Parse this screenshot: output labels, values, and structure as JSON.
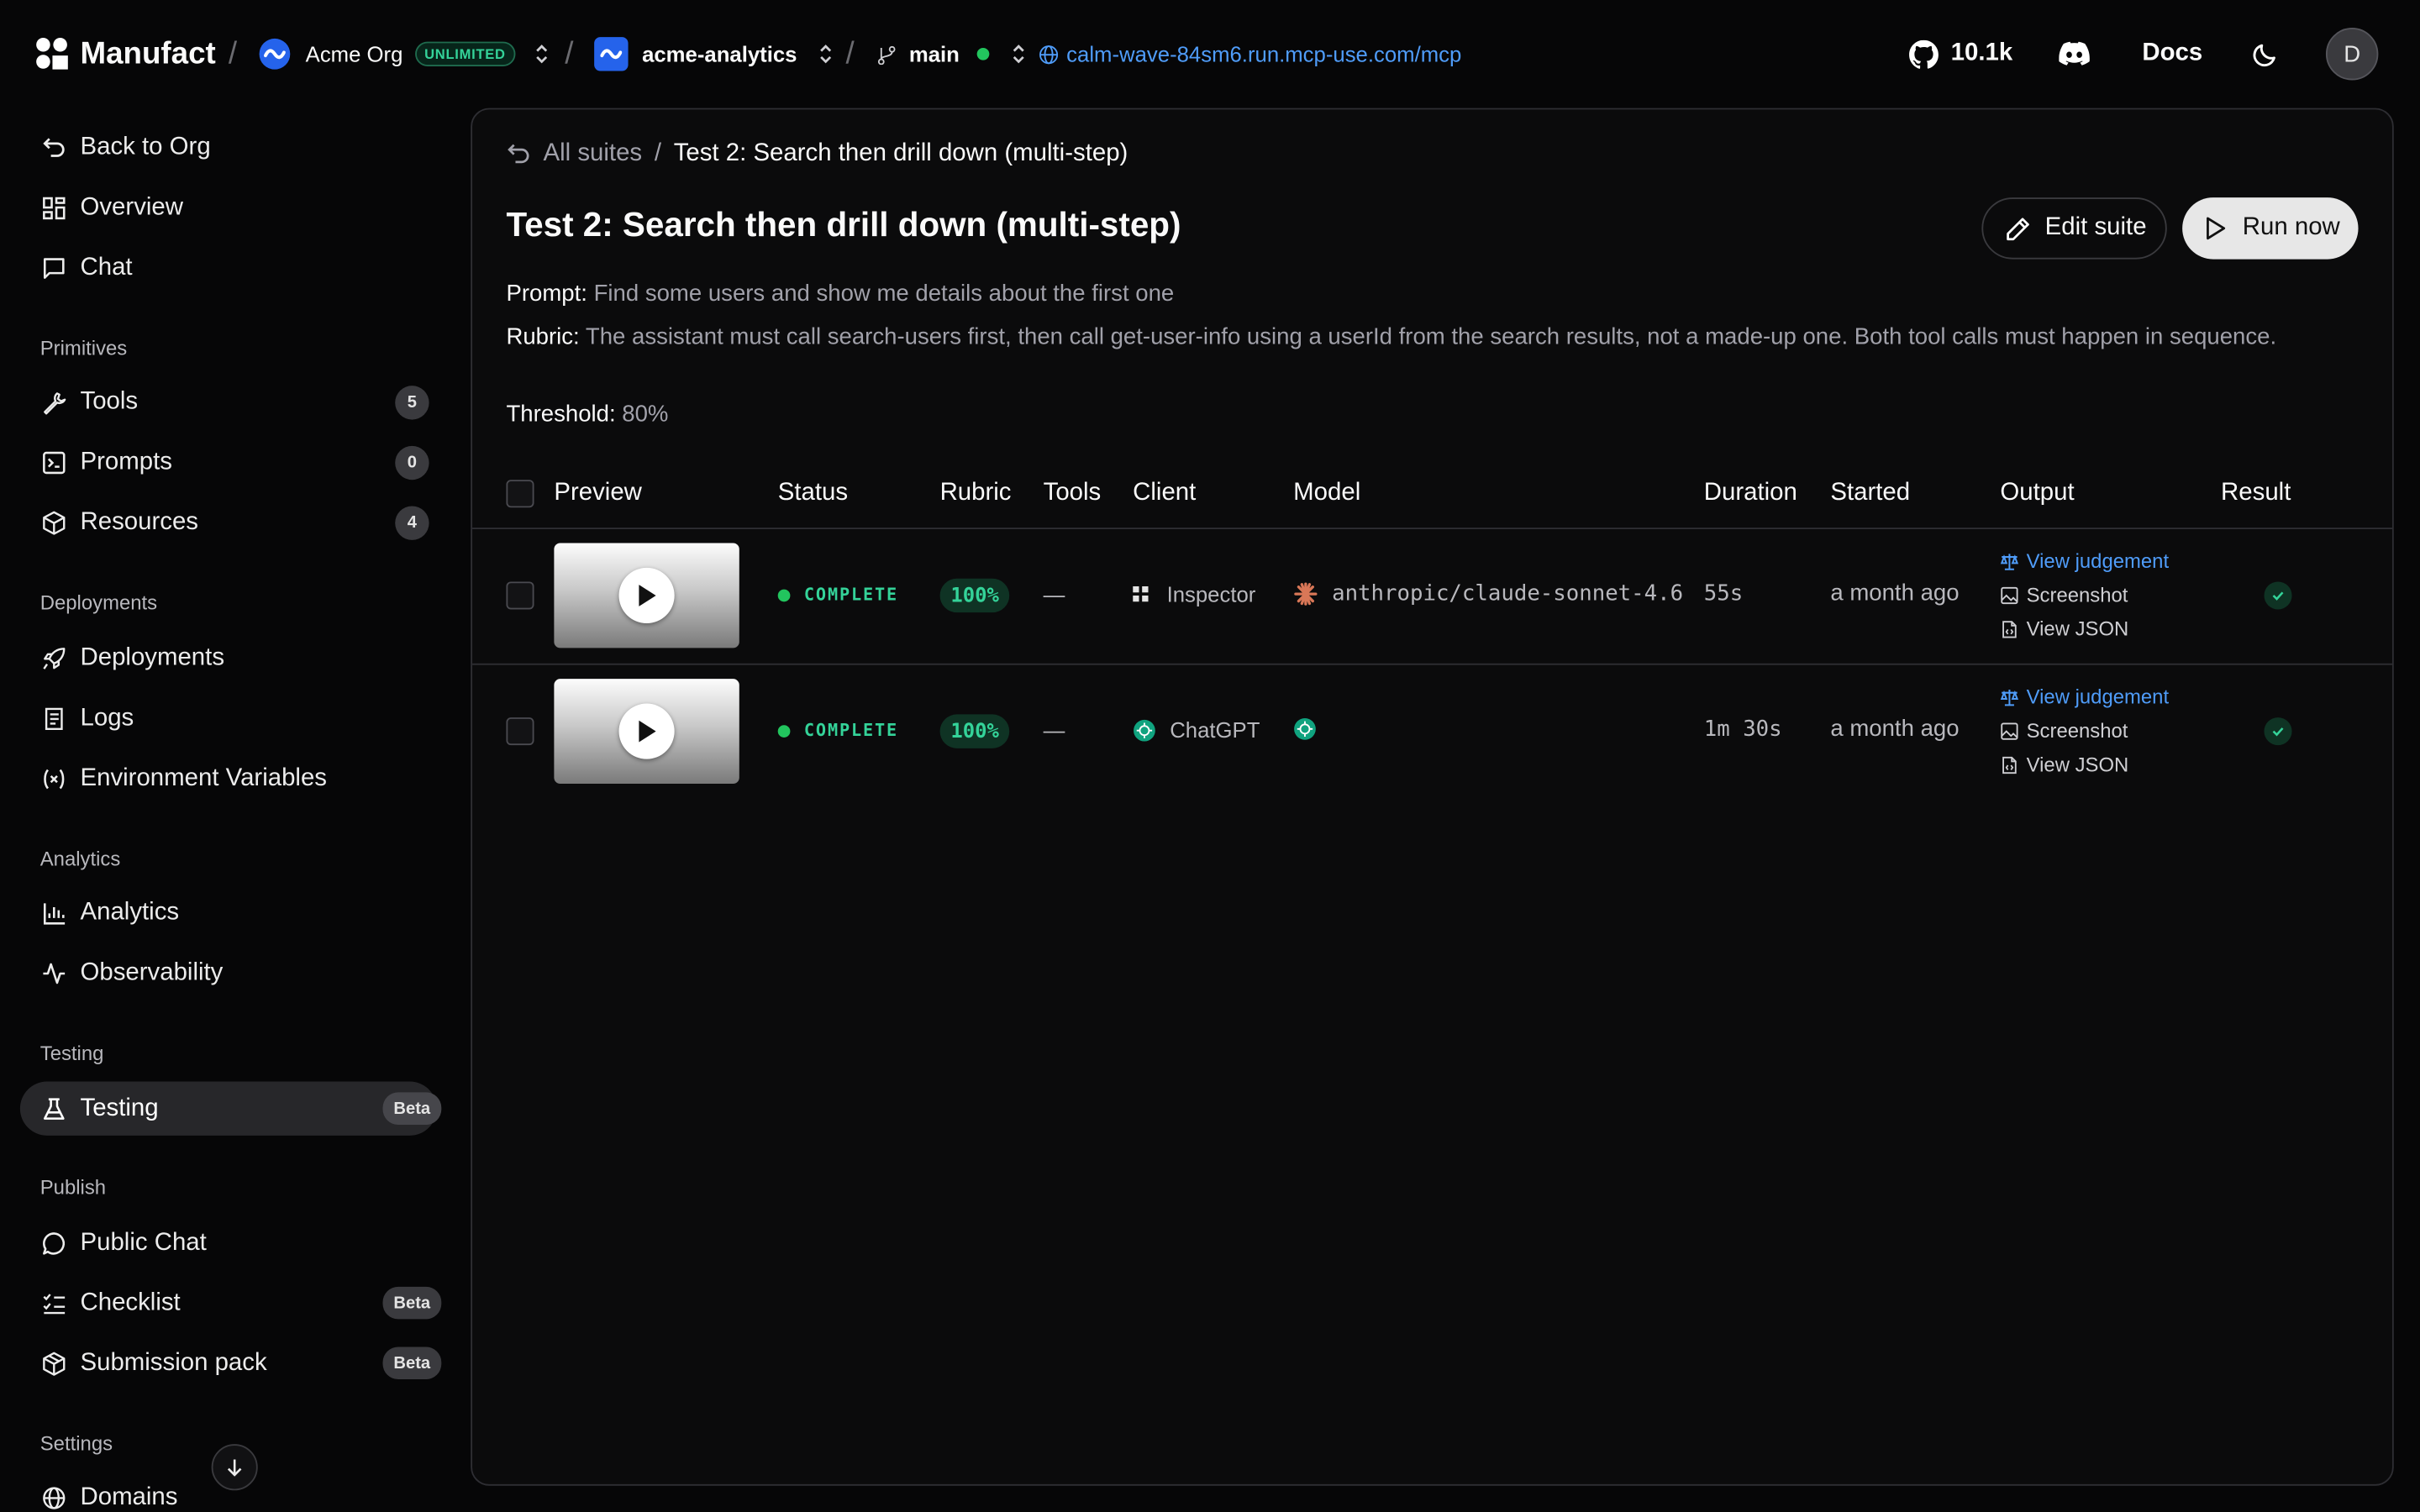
{
  "topbar": {
    "brand": "Manufact",
    "org_name": "Acme Org",
    "org_badge": "UNLIMITED",
    "project_name": "acme-analytics",
    "branch": "main",
    "server_url": "calm-wave-84sm6.run.mcp-use.com/mcp",
    "github_stars": "10.1k",
    "docs_label": "Docs",
    "avatar_initial": "D"
  },
  "sidebar": {
    "top_items": [
      {
        "label": "Back to Org",
        "icon": "back-arrow-icon"
      },
      {
        "label": "Overview",
        "icon": "grid-icon"
      },
      {
        "label": "Chat",
        "icon": "chat-icon"
      }
    ],
    "sections": [
      {
        "title": "Primitives",
        "items": [
          {
            "label": "Tools",
            "icon": "wrench-icon",
            "count": "5"
          },
          {
            "label": "Prompts",
            "icon": "terminal-icon",
            "count": "0"
          },
          {
            "label": "Resources",
            "icon": "box-icon",
            "count": "4"
          }
        ]
      },
      {
        "title": "Deployments",
        "items": [
          {
            "label": "Deployments",
            "icon": "rocket-icon"
          },
          {
            "label": "Logs",
            "icon": "logs-icon"
          },
          {
            "label": "Environment Variables",
            "icon": "variable-icon"
          }
        ]
      },
      {
        "title": "Analytics",
        "items": [
          {
            "label": "Analytics",
            "icon": "bar-chart-icon"
          },
          {
            "label": "Observability",
            "icon": "activity-icon"
          }
        ]
      },
      {
        "title": "Testing",
        "items": [
          {
            "label": "Testing",
            "icon": "flask-icon",
            "badge": "Beta",
            "active": true
          }
        ]
      },
      {
        "title": "Publish",
        "items": [
          {
            "label": "Public Chat",
            "icon": "message-circle-icon"
          },
          {
            "label": "Checklist",
            "icon": "checklist-icon",
            "badge": "Beta"
          },
          {
            "label": "Submission pack",
            "icon": "package-icon",
            "badge": "Beta"
          }
        ]
      },
      {
        "title": "Settings",
        "items": [
          {
            "label": "Domains",
            "icon": "globe-icon"
          }
        ]
      }
    ]
  },
  "main": {
    "breadcrumb": {
      "back_label": "All suites",
      "current": "Test 2: Search then drill down (multi-step)"
    },
    "title": "Test 2: Search then drill down (multi-step)",
    "edit_button": "Edit suite",
    "run_button": "Run now",
    "prompt_label": "Prompt:",
    "prompt_text": "Find some users and show me details about the first one",
    "rubric_label": "Rubric:",
    "rubric_text": "The assistant must call search-users first, then call get-user-info using a userId from the search results, not a made-up one. Both tool calls must happen in sequence.",
    "threshold_label": "Threshold:",
    "threshold_value": "80%",
    "table": {
      "columns": [
        "Preview",
        "Status",
        "Rubric",
        "Tools",
        "Client",
        "Model",
        "Duration",
        "Started",
        "Output",
        "Result"
      ],
      "rows": [
        {
          "status": "COMPLETE",
          "rubric": "100%",
          "tools": "—",
          "client": "Inspector",
          "client_icon": "inspector-icon",
          "model": "anthropic/claude-sonnet-4.6",
          "model_icon": "anthropic-icon",
          "duration": "55s",
          "started": "a month ago",
          "outputs": [
            "View judgement",
            "Screenshot",
            "View JSON"
          ],
          "result": "pass"
        },
        {
          "status": "COMPLETE",
          "rubric": "100%",
          "tools": "—",
          "client": "ChatGPT",
          "client_icon": "openai-icon",
          "model": "",
          "model_icon": "openai-icon",
          "duration": "1m 30s",
          "started": "a month ago",
          "outputs": [
            "View judgement",
            "Screenshot",
            "View JSON"
          ],
          "result": "pass"
        }
      ]
    }
  },
  "colors": {
    "background": "#060607",
    "panel": "#0b0b0c",
    "accent_link": "#4f9cf9",
    "success": "#34d399",
    "org_logo": "#2563eb"
  }
}
